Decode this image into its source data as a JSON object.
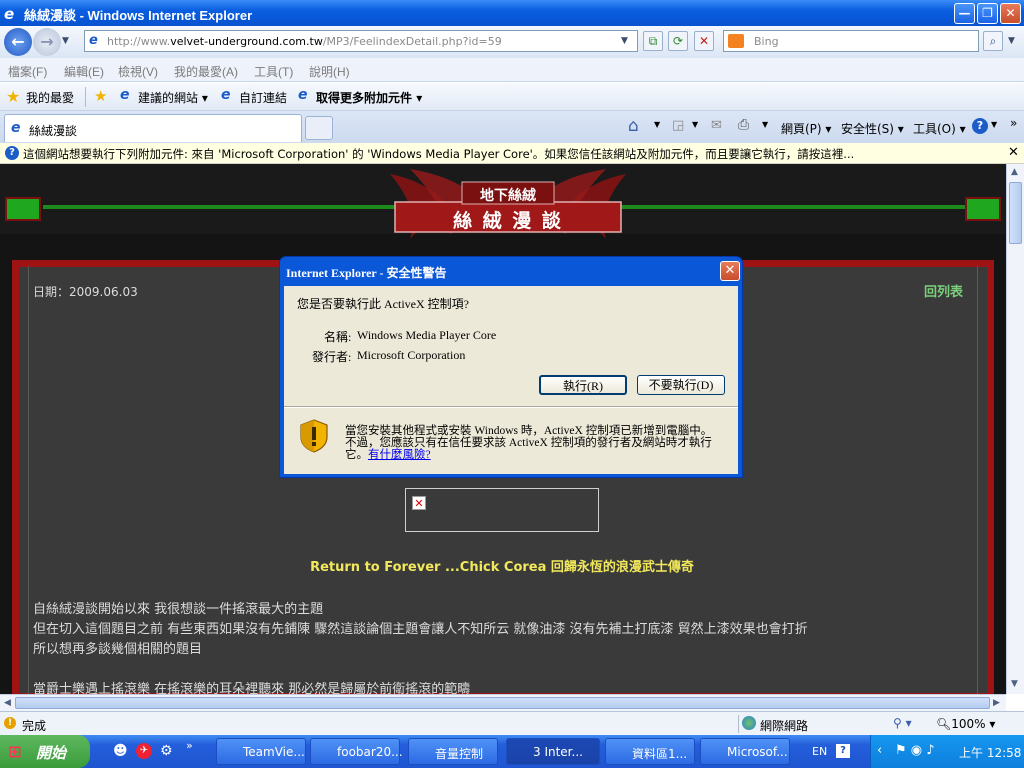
{
  "window": {
    "title": "絲絨漫談 - Windows Internet Explorer",
    "min": "—",
    "max": "❐",
    "close": "✕"
  },
  "nav": {
    "url_prefix": "http://www.",
    "url_host": "velvet-underground.com.tw",
    "url_path": "/MP3/FeelindexDetail.php?id=59",
    "search_placeholder": "Bing"
  },
  "menu": [
    "檔案(F)",
    "編輯(E)",
    "檢視(V)",
    "我的最愛(A)",
    "工具(T)",
    "說明(H)"
  ],
  "favorites": {
    "fav_label": "我的最愛",
    "items": [
      "建議的網站",
      "自訂連結",
      "取得更多附加元件"
    ]
  },
  "tab": {
    "label": "絲絨漫談"
  },
  "toolbar": {
    "page": "網頁(P)",
    "safety": "安全性(S)",
    "tools": "工具(O)"
  },
  "infobar": {
    "text": "這個網站想要執行下列附加元件: 來自 'Microsoft Corporation' 的 'Windows Media Player Core'。如果您信任該網站及附加元件，而且要讓它執行，請按這裡..."
  },
  "page": {
    "banner_small": "地下絲絨",
    "banner_big": "絲 絨 漫 談",
    "date": "日期：2009.06.03",
    "back": "回列表",
    "headline": "Return to Forever ...Chick Corea 回歸永恆的浪漫武士傳奇",
    "paragraphs": [
      "自絲絨漫談開始以來 我很想談一件搖滾最大的主題",
      "但在切入這個題目之前 有些東西如果沒有先鋪陳 驟然這談論個主題會讓人不知所云 就像油漆 沒有先補土打底漆 貿然上漆效果也會打折",
      "所以想再多談幾個相關的題目",
      "當爵士樂遇上搖滾樂 在搖滾樂的耳朵裡聽來 那必然是歸屬於前衛搖滾的範疇"
    ]
  },
  "dialog": {
    "title": "Internet Explorer - 安全性警告",
    "question": "您是否要執行此 ActiveX 控制項?",
    "name_label": "名稱:",
    "name_value": "Windows Media Player Core",
    "publisher_label": "發行者:",
    "publisher_value": "Microsoft Corporation",
    "run": "執行(R)",
    "dont_run": "不要執行(D)",
    "warning_line1": "當您安裝其他程式或安裝 Windows 時，ActiveX 控制項已新增到電腦中。",
    "warning_line2": "不過，您應該只有在信任要求該 ActiveX 控制項的發行者及網站時才執行",
    "warning_line3_prefix": "它。",
    "warning_link": "有什麼風險?"
  },
  "status": {
    "left": "完成",
    "zone": "網際網路",
    "zoom": "100%"
  },
  "taskbar": {
    "start": "開始",
    "tasks": [
      "TeamVie...",
      "foobar20...",
      "音量控制",
      "3 Inter...",
      "資料區1...",
      "Microsof..."
    ],
    "lang": "EN",
    "clock": "上午 12:58"
  },
  "colors": {
    "accent": "#0a57d8",
    "page_bg": "#141414",
    "headline": "#f2e85c",
    "banner_red": "#b01a1a",
    "green": "#1fa81f"
  }
}
